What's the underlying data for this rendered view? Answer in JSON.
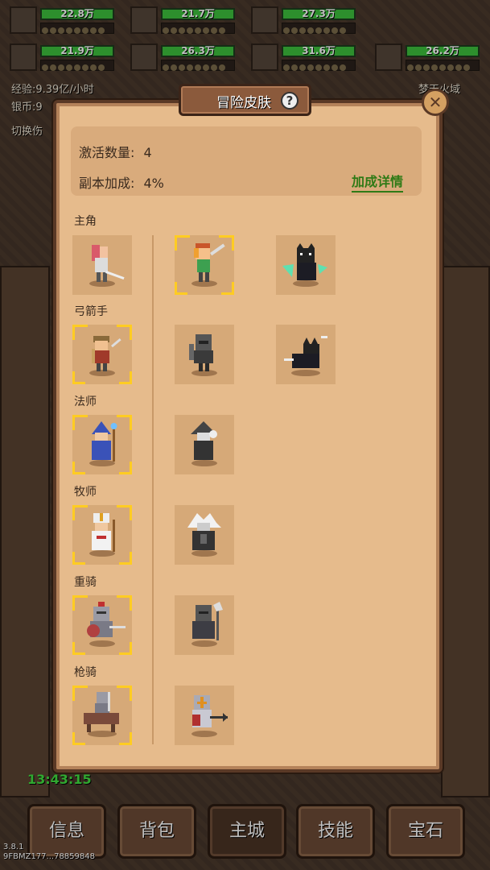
{
  "party": [
    {
      "hp": "22.8万"
    },
    {
      "hp": "21.7万"
    },
    {
      "hp": "27.3万"
    },
    {
      "hp": "21.9万"
    },
    {
      "hp": "26.3万"
    },
    {
      "hp": "31.6万"
    },
    {
      "hp": "26.2万"
    }
  ],
  "background": {
    "exp": "经验:9.39亿/小时",
    "silver": "银币:9",
    "switch": "切换伤",
    "zone": "梦天火域",
    "clock": "13:43:15",
    "version": "3.8.1",
    "device_id": "9FBMZ177...78859848"
  },
  "bottom_tabs": [
    "信息",
    "背包",
    "主城",
    "技能",
    "宝石"
  ],
  "modal": {
    "title": "冒险皮肤",
    "help": "?",
    "close": "✕",
    "activated_label": "激活数量:",
    "activated_value": "4",
    "bonus_label": "副本加成:",
    "bonus_value": "4%",
    "detail_link": "加成详情"
  },
  "categories": [
    {
      "label": "主角"
    },
    {
      "label": "弓箭手"
    },
    {
      "label": "法师"
    },
    {
      "label": "牧师"
    },
    {
      "label": "重骑"
    },
    {
      "label": "枪骑"
    }
  ],
  "colors": {
    "panel": "#e6bb8c",
    "selection": "#ffcc22",
    "link": "#2f7a16",
    "hp_bar": "#3cbf3c"
  }
}
